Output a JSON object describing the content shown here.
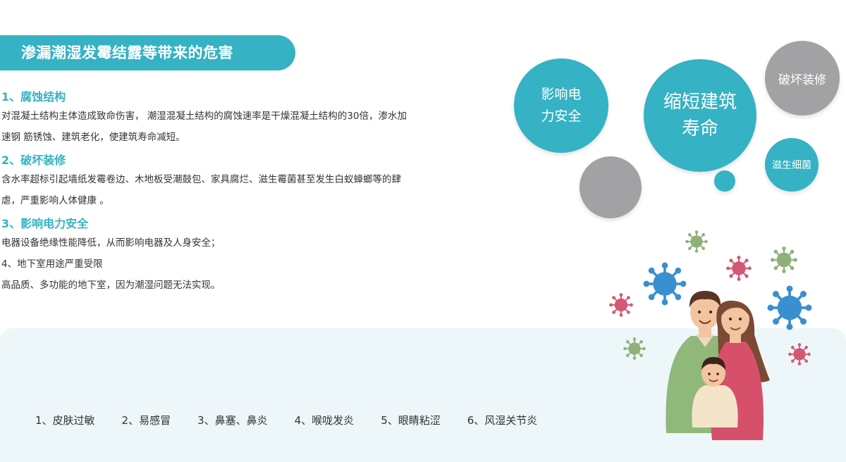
{
  "title": "渗漏潮湿发霉结露等带来的危害",
  "sections": [
    {
      "heading": "1、腐蚀结构",
      "lines": [
        "对混凝土结构主体造成致命伤害， 潮湿混凝土结构的腐蚀速率是干燥混凝土结构的30倍，渗水加",
        "速钢 筋锈蚀、建筑老化，使建筑寿命减短。"
      ]
    },
    {
      "heading": "2、破坏装修",
      "lines": [
        "含水率超标引起墙纸发霉卷边、木地板受潮鼓包、家具腐烂、滋生霉菌甚至发生白蚁蟑螂等的肆",
        "虐，严重影响人体健康 。"
      ]
    },
    {
      "heading": "3、影响电力安全",
      "lines": [
        "电器设备绝缘性能降低，从而影响电器及人身安全；",
        "4、地下室用途严重受限",
        "高品质、多功能的地下室，因为潮湿问题无法实现。"
      ]
    }
  ],
  "bubbles": {
    "power": [
      "影响电",
      "力安全"
    ],
    "lifespan": [
      "缩短建筑",
      "寿命"
    ],
    "decor": "破坏装修",
    "bacteria": "滋生细菌"
  },
  "symptoms": [
    "1、皮肤过敏",
    "2、易感冒",
    "3、鼻塞、鼻炎",
    "4、喉咙发炎",
    "5、眼睛粘涩",
    "6、风湿关节炎"
  ],
  "colors": {
    "accent": "#35b2c3",
    "gray_bubble": "#a2a2a5",
    "panel_bg": "#edf6f9"
  },
  "icons": [
    "virus-icon",
    "family-illustration"
  ]
}
